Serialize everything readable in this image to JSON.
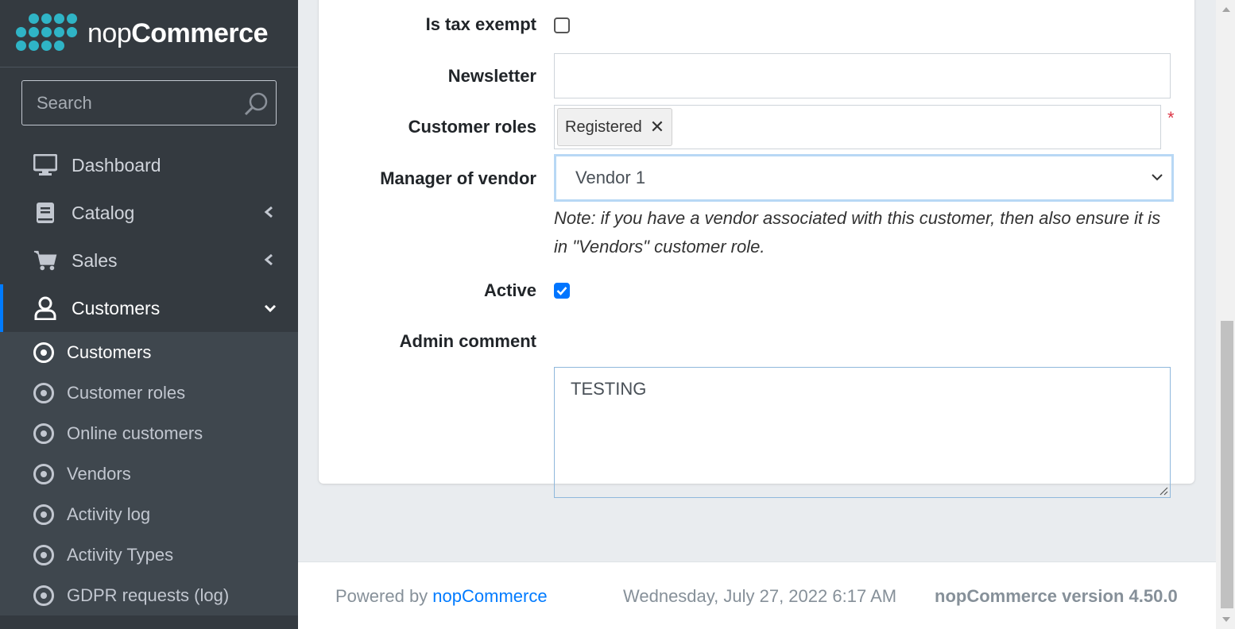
{
  "brand": {
    "name_light": "nop",
    "name_bold": "Commerce"
  },
  "search": {
    "placeholder": "Search"
  },
  "nav": {
    "items": [
      {
        "label": "Dashboard",
        "icon": "monitor-icon"
      },
      {
        "label": "Catalog",
        "icon": "book-icon"
      },
      {
        "label": "Sales",
        "icon": "cart-icon"
      },
      {
        "label": "Customers",
        "icon": "user-icon"
      }
    ],
    "sub_items": [
      {
        "label": "Customers"
      },
      {
        "label": "Customer roles"
      },
      {
        "label": "Online customers"
      },
      {
        "label": "Vendors"
      },
      {
        "label": "Activity log"
      },
      {
        "label": "Activity Types"
      },
      {
        "label": "GDPR requests (log)"
      }
    ]
  },
  "form": {
    "tax_exempt": {
      "label": "Is tax exempt",
      "checked": false
    },
    "newsletter": {
      "label": "Newsletter",
      "value": ""
    },
    "customer_roles": {
      "label": "Customer roles",
      "tags": [
        "Registered"
      ],
      "required_mark": "*"
    },
    "manager_of_vendor": {
      "label": "Manager of vendor",
      "value": "Vendor 1"
    },
    "note": "Note: if you have a vendor associated with this customer, then also ensure it is in \"Vendors\" customer role.",
    "active": {
      "label": "Active",
      "checked": true
    },
    "admin_comment": {
      "label": "Admin comment",
      "value": "TESTING"
    }
  },
  "footer": {
    "powered_prefix": "Powered by ",
    "powered_link": "nopCommerce",
    "datetime": "Wednesday, July 27, 2022 6:17 AM",
    "version": "nopCommerce version 4.50.0"
  },
  "colors": {
    "sidebar_bg": "#343a40",
    "accent": "#007bff",
    "brand": "#2fb4c6",
    "required": "#dc3545"
  }
}
